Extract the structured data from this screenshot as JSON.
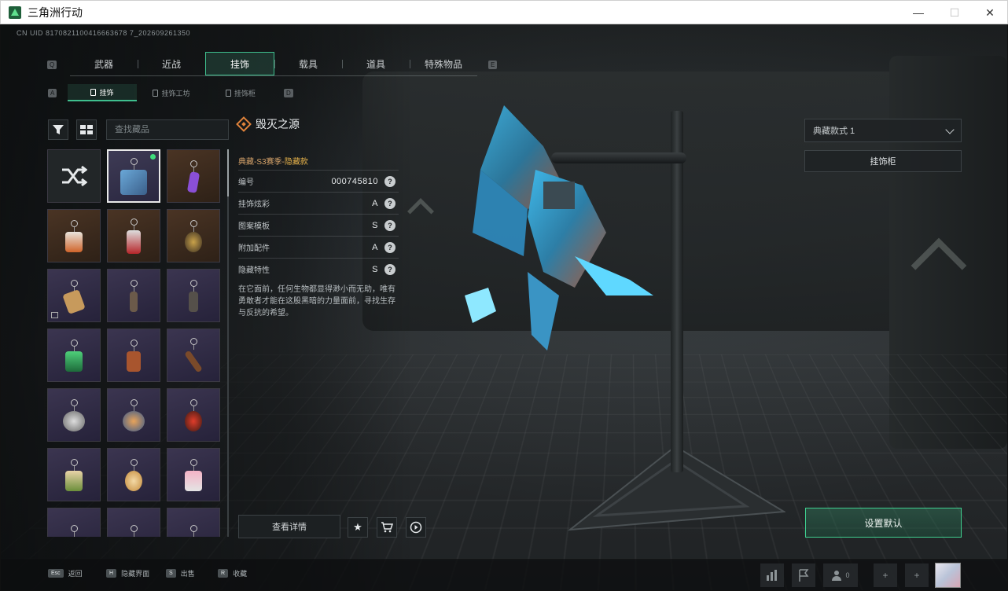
{
  "window": {
    "title": "三角洲行动",
    "minimize": "—",
    "maximize": "☐",
    "close": "✕"
  },
  "uid": "CN UID 8170821100416663678 7_202609261350",
  "main_tabs": {
    "left_key": "Q",
    "right_key": "E",
    "items": [
      {
        "label": "武器"
      },
      {
        "label": "近战"
      },
      {
        "label": "挂饰"
      },
      {
        "label": "载具"
      },
      {
        "label": "道具"
      },
      {
        "label": "特殊物品"
      }
    ],
    "active_index": 2
  },
  "sub_tabs": {
    "left_key": "A",
    "right_key": "D",
    "items": [
      {
        "label": "挂饰"
      },
      {
        "label": "挂饰工坊"
      },
      {
        "label": "挂饰柜"
      }
    ],
    "active_index": 0
  },
  "search": {
    "placeholder": "查找藏品"
  },
  "detail": {
    "title": "毁灭之源",
    "rarity_prefix": "典藏-S3赛季-",
    "rarity_hidden": "隐藏款",
    "attributes": [
      {
        "label": "编号",
        "value": "000745810"
      },
      {
        "label": "挂饰炫彩",
        "value": "A"
      },
      {
        "label": "图案模板",
        "value": "S"
      },
      {
        "label": "附加配件",
        "value": "A"
      },
      {
        "label": "隐藏特性",
        "value": "S"
      }
    ],
    "description": "在它面前，任何生物都显得渺小而无助，唯有勇敢者才能在这股黑暗的力量面前，寻找生存与反抗的希望。",
    "view_details": "查看详情"
  },
  "right_panel": {
    "style_select": "典藏款式 1",
    "rack_button": "挂饰柜",
    "set_default": "设置默认"
  },
  "bottom_hints": [
    {
      "key": "Esc",
      "label": "返回"
    },
    {
      "key": "H",
      "label": "隐藏界面"
    },
    {
      "key": "S",
      "label": "出售"
    },
    {
      "key": "R",
      "label": "收藏"
    }
  ],
  "bottom_right": {
    "friends_count": "0"
  },
  "colors": {
    "accent": "#3fbf8e",
    "rarity": "#e8b34b",
    "diamond": "#e0833b",
    "new_dot": "#3fdd7c"
  }
}
